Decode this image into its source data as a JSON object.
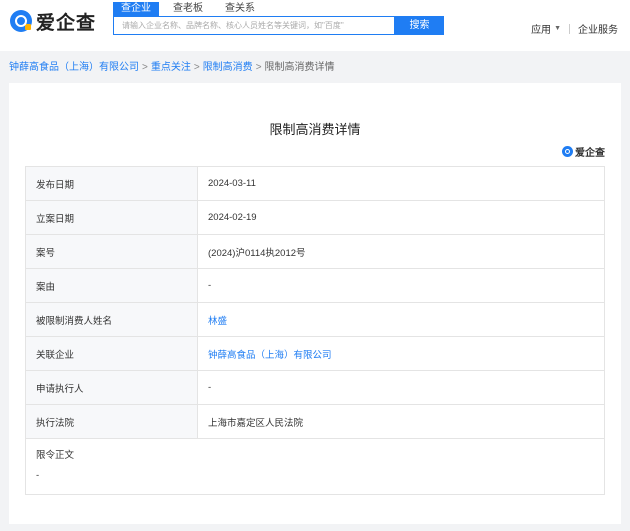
{
  "header": {
    "logo_text": "爱企查",
    "tabs": [
      {
        "label": "查企业",
        "active": true
      },
      {
        "label": "查老板",
        "active": false
      },
      {
        "label": "查关系",
        "active": false
      }
    ],
    "search_placeholder": "请输入企业名称、品牌名称、核心人员姓名等关键词，如\"百度\"",
    "search_button": "搜索",
    "nav": {
      "apps": "应用",
      "enterprise_service": "企业服务"
    }
  },
  "breadcrumb": {
    "items": [
      "钟薛高食品（上海）有限公司",
      "重点关注",
      "限制高消费"
    ],
    "current": "限制高消费详情"
  },
  "detail": {
    "title": "限制高消费详情",
    "watermark": "爱企查",
    "rows": [
      {
        "label": "发布日期",
        "value": "2024-03-11"
      },
      {
        "label": "立案日期",
        "value": "2024-02-19"
      },
      {
        "label": "案号",
        "value": "(2024)沪0114执2012号"
      },
      {
        "label": "案由",
        "value": "-"
      },
      {
        "label": "被限制消费人姓名",
        "value": "林盛"
      },
      {
        "label": "关联企业",
        "value": "钟薛高食品（上海）有限公司"
      },
      {
        "label": "申请执行人",
        "value": "-"
      },
      {
        "label": "执行法院",
        "value": "上海市嘉定区人民法院"
      }
    ],
    "order_label": "限令正文",
    "order_value": "-"
  },
  "colors": {
    "accent": "#1f7df3",
    "background": "#f2f3f5"
  }
}
